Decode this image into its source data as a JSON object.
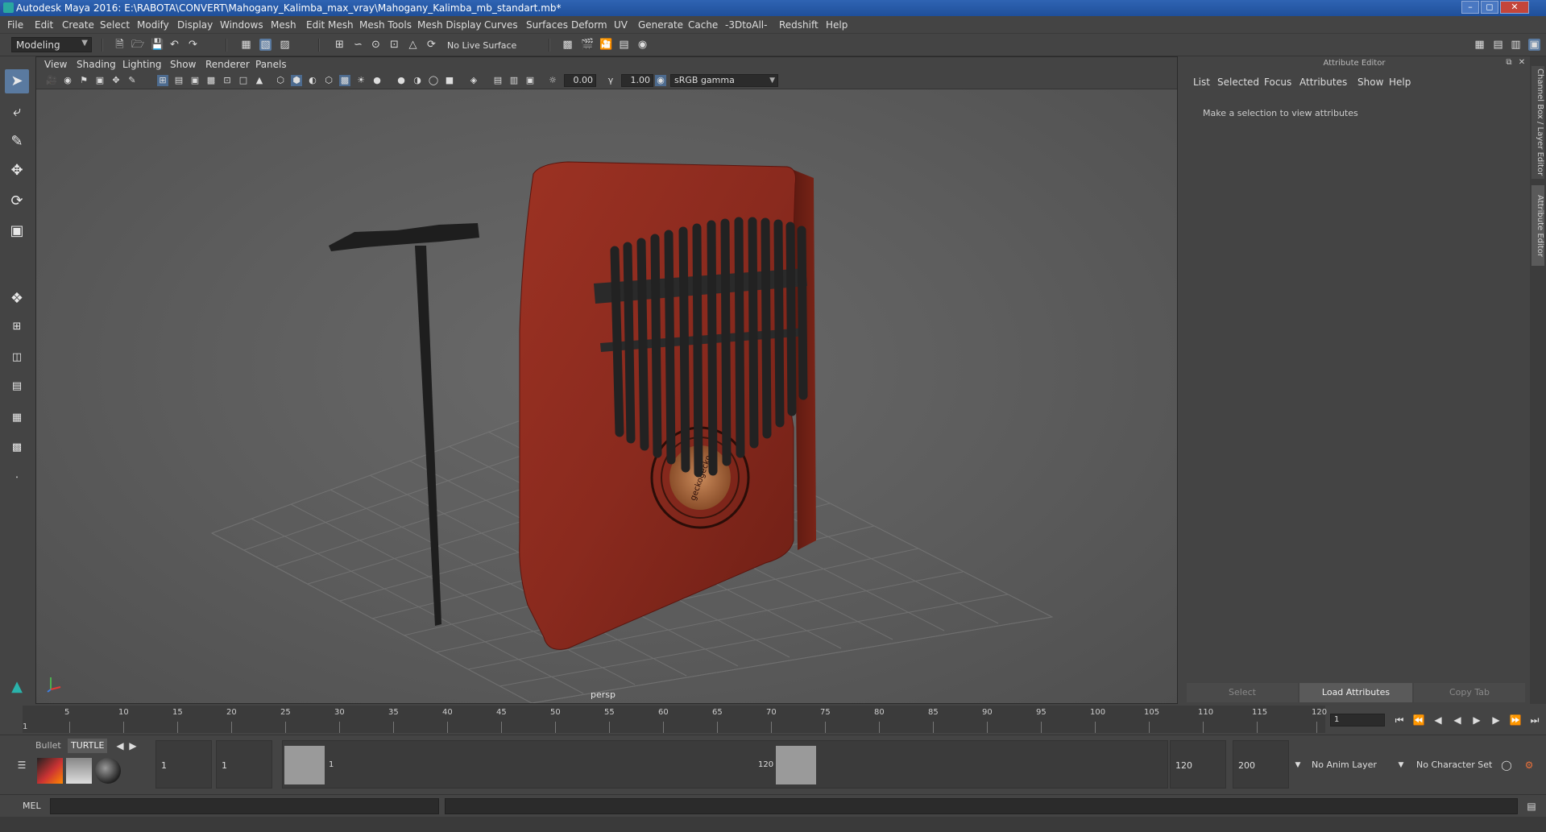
{
  "window": {
    "title": "Autodesk Maya 2016: E:\\RABOTA\\CONVERT\\Mahogany_Kalimba_max_vray\\Mahogany_Kalimba_mb_standart.mb*"
  },
  "menubar": [
    "File",
    "Edit",
    "Create",
    "Select",
    "Modify",
    "Display",
    "Windows",
    "Mesh",
    "Edit Mesh",
    "Mesh Tools",
    "Mesh Display",
    "Curves",
    "Surfaces",
    "Deform",
    "UV",
    "Generate",
    "Cache",
    "-3DtoAll-",
    "Redshift",
    "Help"
  ],
  "shelf": {
    "mode": "Modeling",
    "live_surface": "No Live Surface"
  },
  "viewport": {
    "menu": [
      "View",
      "Shading",
      "Lighting",
      "Show",
      "Renderer",
      "Panels"
    ],
    "exposure": "0.00",
    "gamma": "1.00",
    "color_space": "sRGB gamma",
    "camera": "persp",
    "scene_text": "geckogecko"
  },
  "attribute_editor": {
    "title": "Attribute Editor",
    "tabs": [
      "List",
      "Selected",
      "Focus",
      "Attributes",
      "Show",
      "Help"
    ],
    "hint": "Make a selection to view attributes",
    "buttons": {
      "select": "Select",
      "load": "Load Attributes",
      "copy_tab": "Copy Tab"
    }
  },
  "side_tabs": [
    "Channel Box / Layer Editor",
    "Attribute Editor"
  ],
  "timeline": {
    "ticks": [
      "5",
      "10",
      "15",
      "20",
      "25",
      "30",
      "35",
      "40",
      "45",
      "50",
      "55",
      "60",
      "65",
      "70",
      "75",
      "80",
      "85",
      "90",
      "95",
      "100",
      "105",
      "110",
      "115",
      "120"
    ],
    "start_tick": "1",
    "current_frame": "1"
  },
  "range": {
    "start": "1",
    "playback_start": "1",
    "handle_start": "1",
    "handle_end": "120",
    "playback_end": "120",
    "end": "200",
    "anim_layer": "No Anim Layer",
    "character_set": "No Character Set"
  },
  "shelf_tabs": {
    "bullet": "Bullet",
    "turtle": "TURTLE"
  },
  "cmdline": {
    "mel": "MEL"
  },
  "colors": {
    "wood": "#8a2a1e",
    "tines": "#252525",
    "grid": "#7a7a7a",
    "selection": "#5a7aa0"
  }
}
